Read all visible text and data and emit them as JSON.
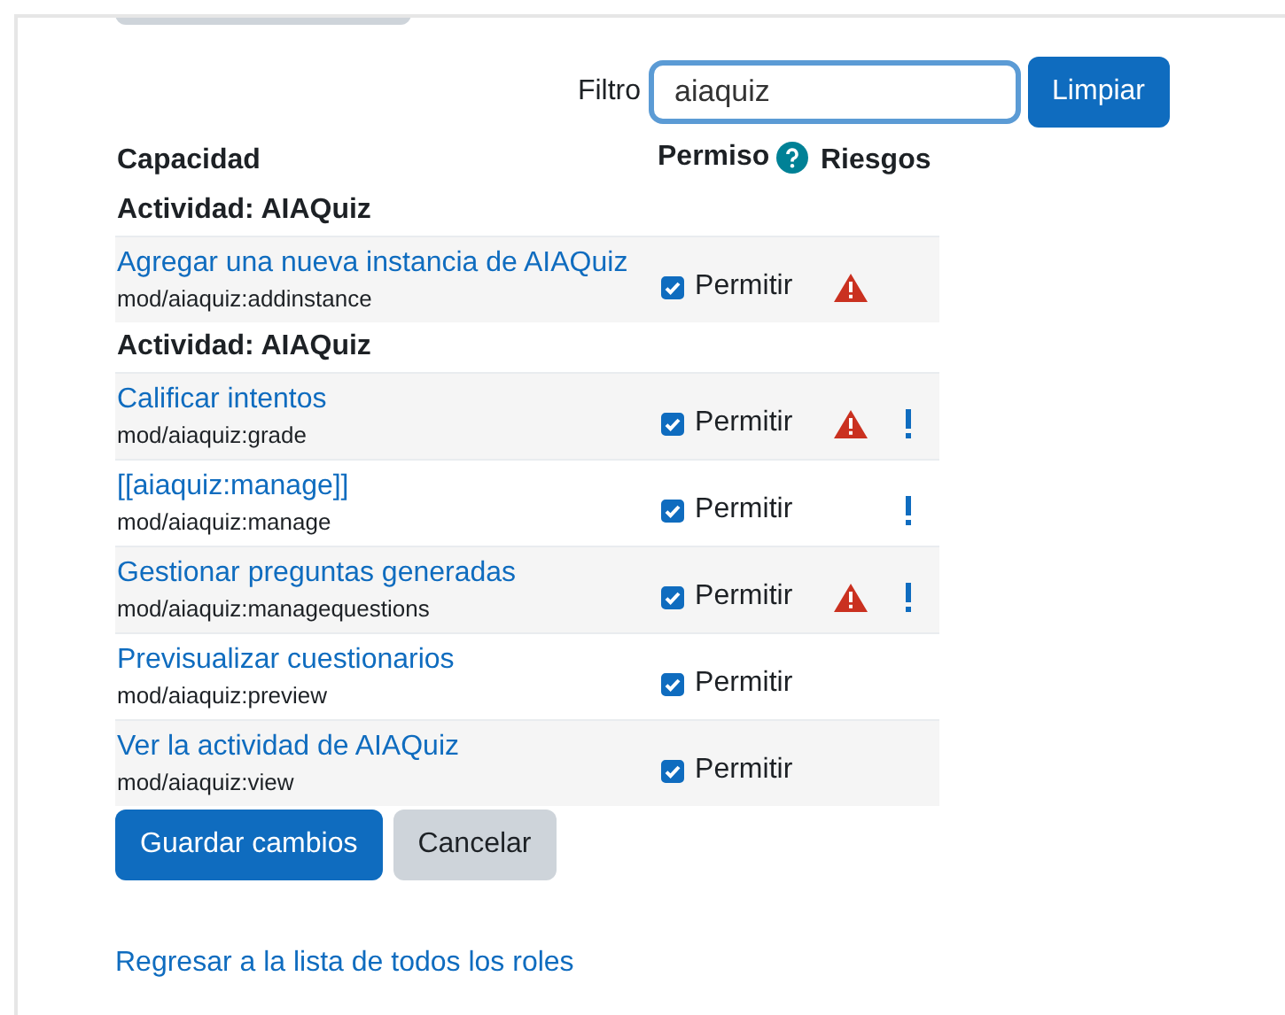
{
  "filter": {
    "label": "Filtro",
    "value": "aiaquiz",
    "button": "Limpiar"
  },
  "columns": {
    "capability": "Capacidad",
    "permission": "Permiso",
    "risks": "Riesgos"
  },
  "groups": [
    {
      "heading": "Actividad: AIAQuiz",
      "capabilities": [
        {
          "name": "Agregar una nueva instancia de AIAQuiz",
          "code": "mod/aiaquiz:addinstance",
          "permission": "Permitir",
          "checked": true,
          "risk_warning": true,
          "risk_exclaim": false
        }
      ]
    },
    {
      "heading": "Actividad: AIAQuiz",
      "capabilities": [
        {
          "name": "Calificar intentos",
          "code": "mod/aiaquiz:grade",
          "permission": "Permitir",
          "checked": true,
          "risk_warning": true,
          "risk_exclaim": true
        },
        {
          "name": "[[aiaquiz:manage]]",
          "code": "mod/aiaquiz:manage",
          "permission": "Permitir",
          "checked": true,
          "risk_warning": false,
          "risk_exclaim": true
        },
        {
          "name": "Gestionar preguntas generadas",
          "code": "mod/aiaquiz:managequestions",
          "permission": "Permitir",
          "checked": true,
          "risk_warning": true,
          "risk_exclaim": true
        },
        {
          "name": "Previsualizar cuestionarios",
          "code": "mod/aiaquiz:preview",
          "permission": "Permitir",
          "checked": true,
          "risk_warning": false,
          "risk_exclaim": false
        },
        {
          "name": "Ver la actividad de AIAQuiz",
          "code": "mod/aiaquiz:view",
          "permission": "Permitir",
          "checked": true,
          "risk_warning": false,
          "risk_exclaim": false
        }
      ]
    }
  ],
  "buttons": {
    "save": "Guardar cambios",
    "cancel": "Cancelar"
  },
  "back_link": "Regresar a la lista de todos los roles"
}
